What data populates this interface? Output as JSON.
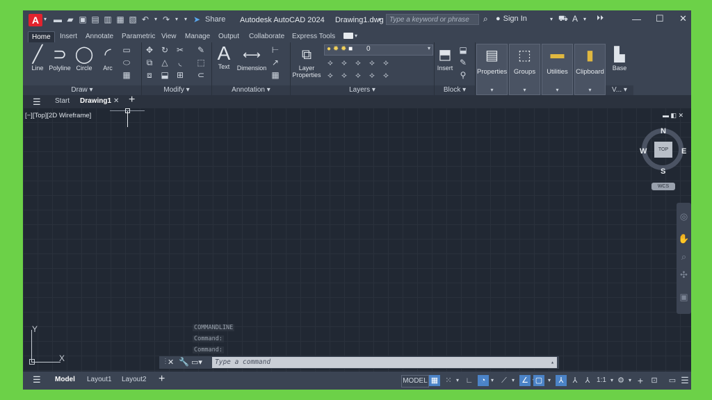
{
  "app": {
    "logo": "A",
    "title": "Autodesk AutoCAD 2024",
    "filename": "Drawing1.dwg"
  },
  "quick_access": {
    "share_label": "Share"
  },
  "search": {
    "placeholder": "Type a keyword or phrase"
  },
  "account": {
    "sign_in": "Sign In"
  },
  "ribbon_tabs": [
    "Home",
    "Insert",
    "Annotate",
    "Parametric",
    "View",
    "Manage",
    "Output",
    "Collaborate",
    "Express Tools"
  ],
  "panels": {
    "draw": {
      "title": "Draw",
      "line": "Line",
      "polyline": "Polyline",
      "circle": "Circle",
      "arc": "Arc"
    },
    "modify": {
      "title": "Modify"
    },
    "annotation": {
      "title": "Annotation",
      "text": "Text",
      "dimension": "Dimension"
    },
    "layers": {
      "title": "Layers",
      "layer_properties_1": "Layer",
      "layer_properties_2": "Properties",
      "current_layer": "0"
    },
    "block": {
      "title": "Block",
      "insert": "Insert"
    },
    "properties": "Properties",
    "groups": "Groups",
    "utilities": "Utilities",
    "clipboard": "Clipboard",
    "view": {
      "base": "Base",
      "title": "V..."
    }
  },
  "file_tabs": {
    "start": "Start",
    "drawing": "Drawing1"
  },
  "viewport": {
    "label": "[−][Top][2D Wireframe]",
    "compass": {
      "n": "N",
      "s": "S",
      "e": "E",
      "w": "W",
      "top": "TOP"
    },
    "wcs": "WCS",
    "ucs": {
      "x": "X",
      "y": "Y"
    }
  },
  "command": {
    "history": [
      "COMMANDLINE",
      "Command:",
      "Command:"
    ],
    "placeholder": "Type a command"
  },
  "layout_tabs": [
    "Model",
    "Layout1",
    "Layout2"
  ],
  "status": {
    "model": "MODEL",
    "scale": "1:1"
  },
  "colors": {
    "accent": "#4b83c7",
    "background": "#212833",
    "chrome": "#3b4453",
    "logo": "#e2232e"
  }
}
